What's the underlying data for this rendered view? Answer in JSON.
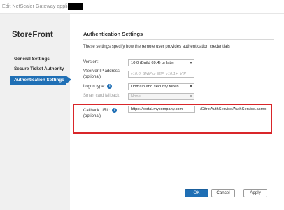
{
  "window": {
    "title": "Edit NetScaler Gateway appliance"
  },
  "sidebar": {
    "brand": "StoreFront",
    "items": [
      {
        "label": "General Settings"
      },
      {
        "label": "Secure Ticket Authority"
      },
      {
        "label": "Authentication Settings",
        "active": true
      }
    ]
  },
  "main": {
    "section_title": "Authentication Settings",
    "description": "These settings specify how the remote user provides authentication credentials",
    "fields": {
      "version": {
        "label": "Version:",
        "value": "10.0 (Build 69.4) or later"
      },
      "vserver_ip": {
        "label": "VServer IP address:",
        "sublabel": "(optional)",
        "placeholder": "v10.0: SNIP or MIP, v10.1+: VIP"
      },
      "logon_type": {
        "label": "Logon type:",
        "value": "Domain and security token"
      },
      "smart_card": {
        "label": "Smart card fallback:",
        "value": "None"
      },
      "callback": {
        "label": "Callback URL:",
        "sublabel": "(optional)",
        "value": "https://portal.mycompany.com",
        "suffix": "/CitrixAuthService/AuthService.asmx"
      }
    },
    "info_icon_glyph": "i"
  },
  "buttons": {
    "ok": "OK",
    "cancel": "Cancel",
    "apply": "Apply"
  },
  "colors": {
    "accent": "#1f6fb5",
    "highlight": "#d9262a",
    "sidebar_bg": "#f0f0f0"
  }
}
